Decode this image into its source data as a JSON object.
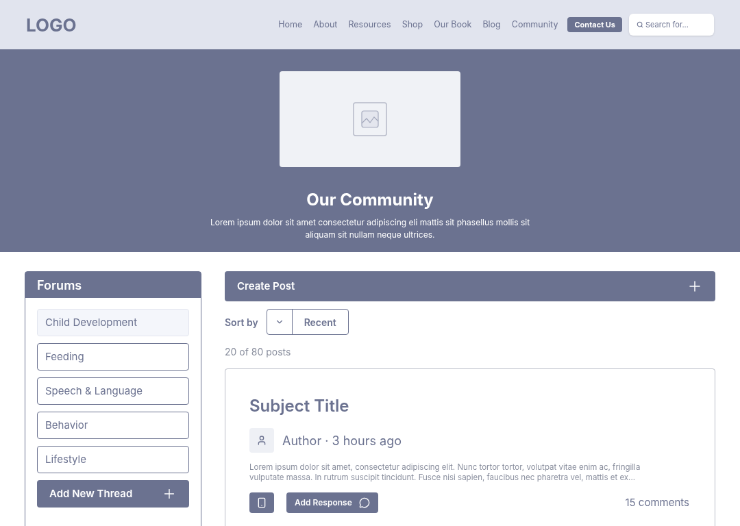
{
  "header": {
    "logo": "LOGO",
    "nav": [
      {
        "label": "Home",
        "kind": "link"
      },
      {
        "label": "About",
        "kind": "link"
      },
      {
        "label": "Resources",
        "kind": "link"
      },
      {
        "label": "Shop",
        "kind": "link"
      },
      {
        "label": "Our Book",
        "kind": "link"
      },
      {
        "label": "Blog",
        "kind": "link"
      },
      {
        "label": "Community",
        "kind": "link"
      },
      {
        "label": "Contact Us",
        "kind": "button"
      }
    ],
    "search": {
      "placeholder": "Search for..."
    }
  },
  "hero": {
    "title": "Our Community",
    "text": "Lorem ipsum dolor sit amet consectetur adipiscing eli mattis sit phasellus mollis sit aliquam sit nullam neque ultrices."
  },
  "sidebar": {
    "title": "Forums",
    "items": [
      {
        "label": "Child Development",
        "selected": true
      },
      {
        "label": "Feeding",
        "selected": false
      },
      {
        "label": "Speech & Language",
        "selected": false
      },
      {
        "label": "Behavior",
        "selected": false
      },
      {
        "label": "Lifestyle",
        "selected": false
      }
    ],
    "add_button": "Add New Thread"
  },
  "main": {
    "create_post": "Create Post",
    "sort": {
      "label": "Sort by",
      "value": "Recent"
    },
    "count": "20 of 80 posts",
    "post": {
      "title": "Subject Title",
      "author": "Author · 3 hours ago",
      "body": "Lorem ipsum dolor sit amet, consectetur adipiscing elit. Nunc tortor tortor, volutpat vitae enim ac, fringilla vulputate massa. In rutrum suscipit tincidunt. Fusce nisi sapien, faucibus nec pharetra vel, mattis et ex...",
      "response_button": "Add Response",
      "comments": "15 comments"
    }
  }
}
